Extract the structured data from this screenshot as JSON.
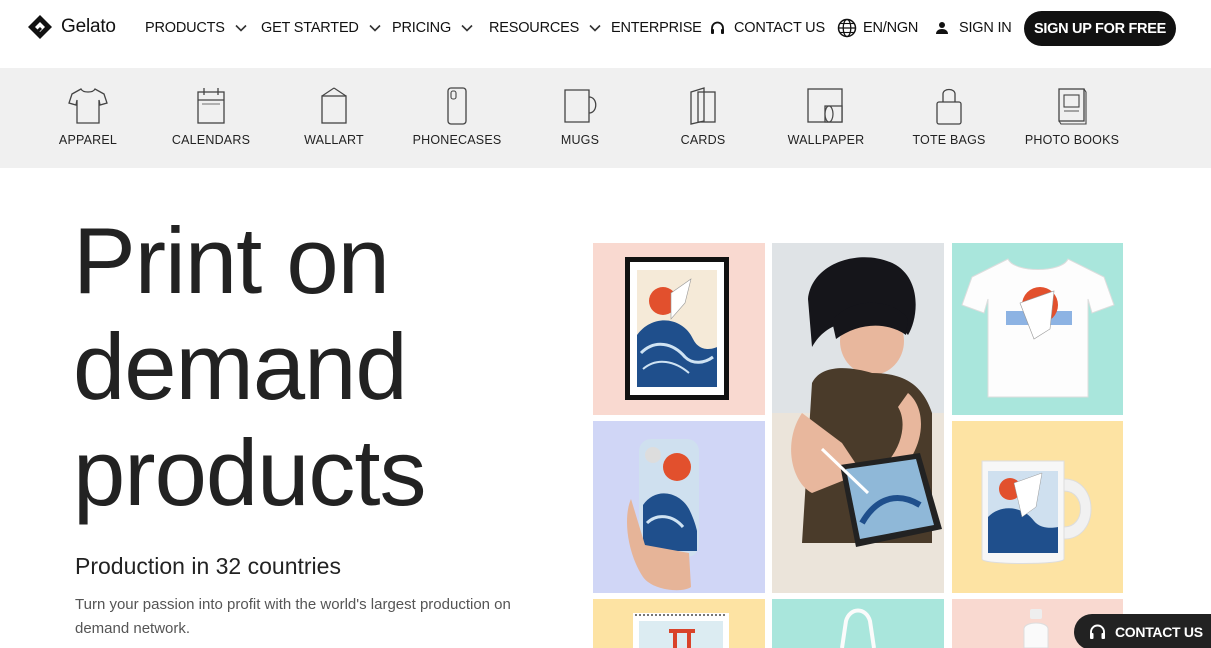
{
  "brand": {
    "name": "Gelato"
  },
  "nav": {
    "items": [
      {
        "label": "PRODUCTS",
        "has_dropdown": true
      },
      {
        "label": "GET STARTED",
        "has_dropdown": true
      },
      {
        "label": "PRICING",
        "has_dropdown": true
      },
      {
        "label": "RESOURCES",
        "has_dropdown": true
      },
      {
        "label": "ENTERPRISE",
        "has_dropdown": false
      }
    ],
    "contact_label": "CONTACT US",
    "locale_label": "EN/NGN",
    "signin_label": "SIGN IN",
    "signup_label": "SIGN UP FOR FREE"
  },
  "categories": [
    {
      "label": "APPAREL",
      "icon": "tshirt-icon"
    },
    {
      "label": "CALENDARS",
      "icon": "calendar-icon"
    },
    {
      "label": "WALLART",
      "icon": "wallart-icon"
    },
    {
      "label": "PHONECASES",
      "icon": "phone-case-icon"
    },
    {
      "label": "MUGS",
      "icon": "mug-icon"
    },
    {
      "label": "CARDS",
      "icon": "cards-icon"
    },
    {
      "label": "WALLPAPER",
      "icon": "wallpaper-icon"
    },
    {
      "label": "TOTE BAGS",
      "icon": "tote-bag-icon"
    },
    {
      "label": "PHOTO BOOKS",
      "icon": "photo-book-icon"
    }
  ],
  "hero": {
    "title_lines": [
      "Print on",
      "demand",
      "products"
    ],
    "subtitle": "Production in 32 countries",
    "description": "Turn your passion into profit with the world's largest production on demand network."
  },
  "floating_contact": {
    "label": "CONTACT US"
  },
  "colors": {
    "tile_pink": "#f9d9d0",
    "tile_mint": "#a9e6dc",
    "tile_lavender": "#d0d6f6",
    "tile_yellow": "#fde3a3",
    "dark": "#111111",
    "catbar_bg": "#f0f0f0"
  }
}
